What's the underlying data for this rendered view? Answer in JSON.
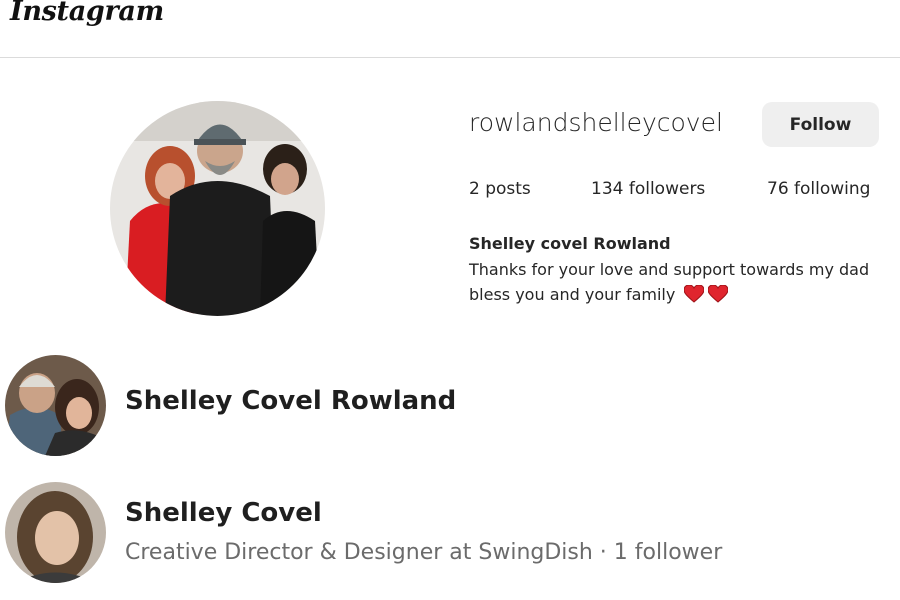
{
  "header": {
    "logo_text": "Instagram"
  },
  "profile": {
    "username": "rowlandshelleycovel",
    "follow_label": "Follow",
    "stats": {
      "posts": "2 posts",
      "followers": "134 followers",
      "following": "76 following"
    },
    "bio_name": "Shelley covel Rowland",
    "bio_line1": "Thanks for your love and support towards my dad",
    "bio_line2": "bless you and your family",
    "heart_emoji_count": 2
  },
  "results": [
    {
      "name": "Shelley Covel Rowland",
      "subtitle": ""
    },
    {
      "name": "Shelley Covel",
      "subtitle": "Creative Director & Designer at SwingDish · 1 follower"
    }
  ],
  "colors": {
    "follow_bg": "#efefef",
    "divider": "#dbdbdb",
    "heart": "#e0252e",
    "subtitle": "#6b6b6b"
  }
}
